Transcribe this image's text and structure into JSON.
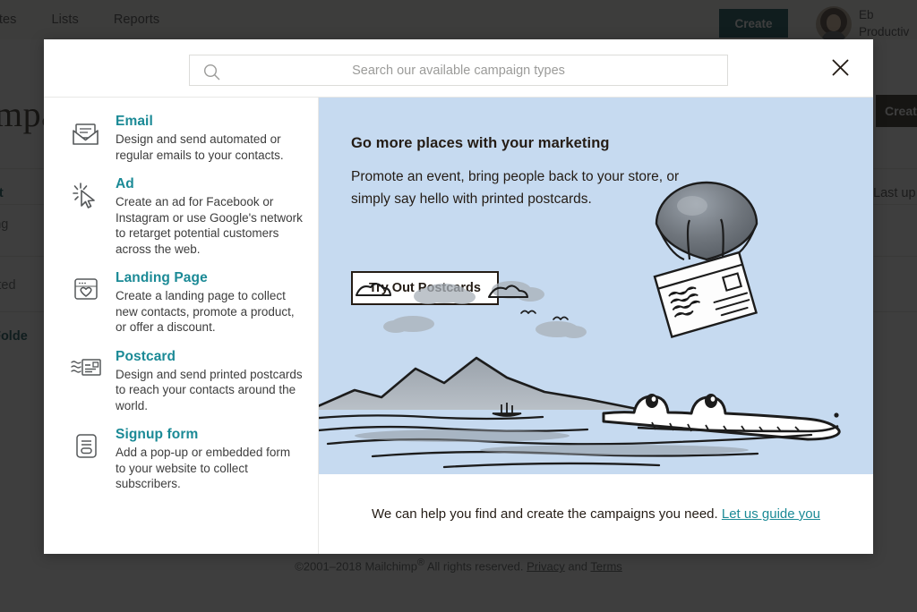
{
  "background": {
    "nav_items": [
      "mplates",
      "Lists",
      "Reports"
    ],
    "create_button": "Create",
    "user_name_line1": "Eb",
    "user_name_line2": "Productiv",
    "page_title": "mpa",
    "create_campaign_button": "Create C",
    "tab_ongoing": "nt",
    "sub_ongoing": "ing",
    "last_updated": "Last up",
    "completed": "pleted",
    "folder_link": "e Folde",
    "copyright_prefix": "©2001–2018 Mailchimp",
    "copyright_reg": "®",
    "copyright_mid": " All rights reserved. ",
    "privacy_label": "Privacy",
    "and_label": " and ",
    "terms_label": "Terms"
  },
  "modal": {
    "search": {
      "placeholder": "Search our available campaign types",
      "value": "",
      "icon": "search-icon"
    },
    "close_icon": "close-icon",
    "campaign_types": [
      {
        "icon": "email-envelope-icon",
        "title": "Email",
        "description": "Design and send automated or regular emails to your contacts."
      },
      {
        "icon": "ad-cursor-click-icon",
        "title": "Ad",
        "description": "Create an ad for Facebook or Instagram or use Google's network to retarget potential customers across the web."
      },
      {
        "icon": "landing-page-heart-icon",
        "title": "Landing Page",
        "description": "Create a landing page to collect new contacts, promote a product, or offer a discount."
      },
      {
        "icon": "postcard-icon",
        "title": "Postcard",
        "description": "Design and send printed postcards to reach your contacts around the world."
      },
      {
        "icon": "signup-form-icon",
        "title": "Signup form",
        "description": "Add a pop-up or embedded form to your website to collect subscribers."
      }
    ],
    "hero": {
      "title": "Go more places with your marketing",
      "subtitle": "Promote an event, bring people back to your store, or simply say hello with printed postcards.",
      "button_label": "Try Out Postcards",
      "illustration": "postcard-parachute-alligator-landscape-illustration",
      "background_color": "#c6daf0"
    },
    "footer": {
      "text": "We can help you find and create the campaigns you need. ",
      "link_label": "Let us guide you"
    }
  },
  "colors": {
    "teal": "#1b8a96",
    "dark_teal": "#00494f",
    "ink": "#241c15",
    "hero_blue": "#c6daf0"
  }
}
